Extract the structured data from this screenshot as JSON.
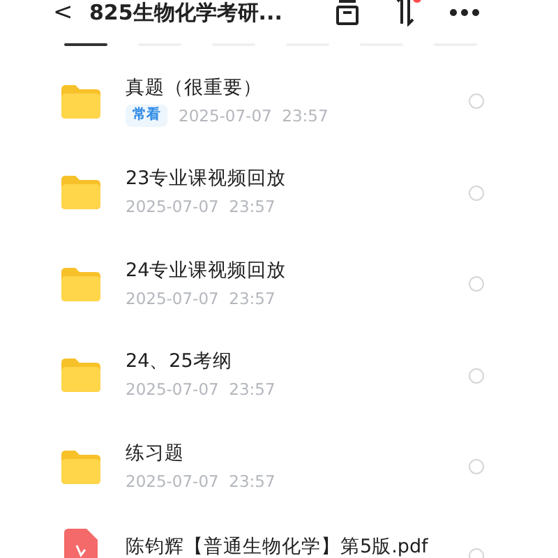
{
  "header": {
    "back": "<",
    "title": "825生物化学考研..."
  },
  "tabs": [
    {
      "selected": true
    },
    {
      "selected": false
    },
    {
      "selected": false
    },
    {
      "selected": false
    },
    {
      "selected": false
    },
    {
      "selected": false
    }
  ],
  "files": [
    {
      "kind": "folder",
      "name": "真题（很重要）",
      "tag": "常看",
      "selected": false,
      "time": "2025-07-07  23:57"
    },
    {
      "kind": "folder",
      "name": "23专业课视频回放",
      "selected": false,
      "time": "2025-07-07  23:57"
    },
    {
      "kind": "folder",
      "name": "24专业课视频回放",
      "selected": false,
      "time": "2025-07-07  23:57"
    },
    {
      "kind": "folder",
      "name": "24、25考纲",
      "selected": false,
      "time": "2025-07-07  23:57"
    },
    {
      "kind": "folder",
      "name": "练习题",
      "selected": false,
      "time": "2025-07-07  23:57"
    },
    {
      "kind": "pdf",
      "name": "陈钧辉【普通生物化学】第5版.pdf",
      "selected": false
    }
  ]
}
